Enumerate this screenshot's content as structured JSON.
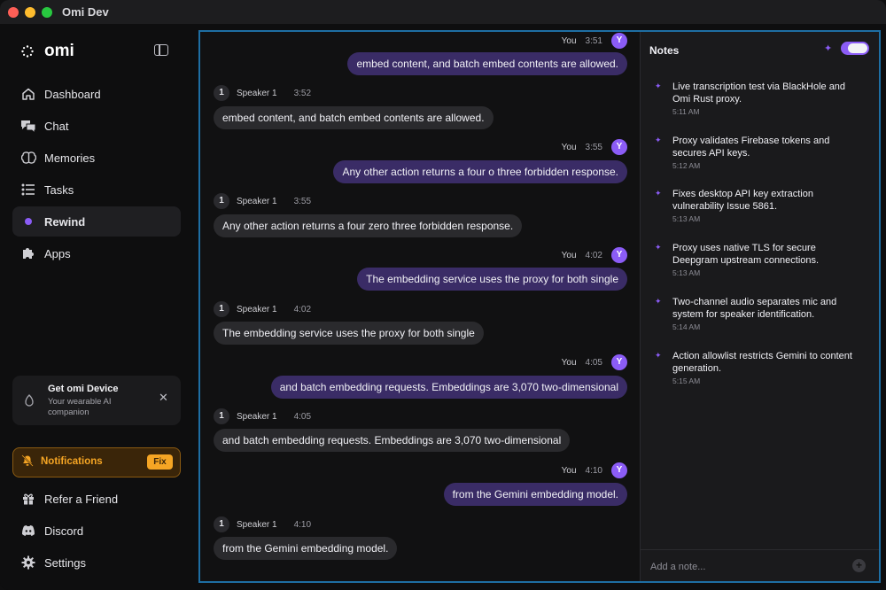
{
  "window": {
    "title": "Omi Dev"
  },
  "sidebar": {
    "logo": "omi",
    "nav": [
      {
        "label": "Dashboard",
        "icon": "home-icon"
      },
      {
        "label": "Chat",
        "icon": "chat-icon"
      },
      {
        "label": "Memories",
        "icon": "brain-icon"
      },
      {
        "label": "Tasks",
        "icon": "tasks-icon"
      },
      {
        "label": "Rewind",
        "icon": "dot-icon",
        "active": true
      },
      {
        "label": "Apps",
        "icon": "puzzle-icon"
      }
    ],
    "promo": {
      "title": "Get omi Device",
      "subtitle": "Your wearable AI companion"
    },
    "notifications": {
      "label": "Notifications",
      "fix_label": "Fix"
    },
    "bottom": [
      {
        "label": "Refer a Friend",
        "icon": "gift-icon"
      },
      {
        "label": "Discord",
        "icon": "discord-icon"
      },
      {
        "label": "Settings",
        "icon": "gear-icon"
      }
    ]
  },
  "chat": {
    "you_label": "You",
    "you_avatar": "Y",
    "speaker_label": "Speaker 1",
    "speaker_avatar": "1",
    "messages": [
      {
        "who": "you",
        "time": "3:51",
        "text": "embed content, and batch embed contents are allowed."
      },
      {
        "who": "speaker",
        "time": "3:52",
        "text": "embed content, and batch embed contents are allowed."
      },
      {
        "who": "you",
        "time": "3:55",
        "text": "Any other action returns a four o three forbidden response."
      },
      {
        "who": "speaker",
        "time": "3:55",
        "text": "Any other action returns a four zero three forbidden response."
      },
      {
        "who": "you",
        "time": "4:02",
        "text": "The embedding service uses the proxy for both single"
      },
      {
        "who": "speaker",
        "time": "4:02",
        "text": "The embedding service uses the proxy for both single"
      },
      {
        "who": "you",
        "time": "4:05",
        "text": "and batch embedding requests. Embeddings are 3,070 two-dimensional"
      },
      {
        "who": "speaker",
        "time": "4:05",
        "text": "and batch embedding requests. Embeddings are 3,070 two-dimensional"
      },
      {
        "who": "you",
        "time": "4:10",
        "text": "from the Gemini embedding model."
      },
      {
        "who": "speaker",
        "time": "4:10",
        "text": "from the Gemini embedding model."
      }
    ]
  },
  "notes": {
    "title": "Notes",
    "toggle_on": true,
    "items": [
      {
        "text": "Live transcription test via BlackHole and Omi Rust proxy.",
        "time": "5:11 AM"
      },
      {
        "text": "Proxy validates Firebase tokens and secures API keys.",
        "time": "5:12 AM"
      },
      {
        "text": "Fixes desktop API key extraction vulnerability Issue 5861.",
        "time": "5:13 AM"
      },
      {
        "text": "Proxy uses native TLS for secure Deepgram upstream connections.",
        "time": "5:13 AM"
      },
      {
        "text": "Two-channel audio separates mic and system for speaker identification.",
        "time": "5:14 AM"
      },
      {
        "text": "Action allowlist restricts Gemini to content generation.",
        "time": "5:15 AM"
      }
    ],
    "add_placeholder": "Add a note..."
  },
  "colors": {
    "accent": "#8b5cf6",
    "warning": "#f5a524",
    "focus_border": "#1e6ea3"
  }
}
